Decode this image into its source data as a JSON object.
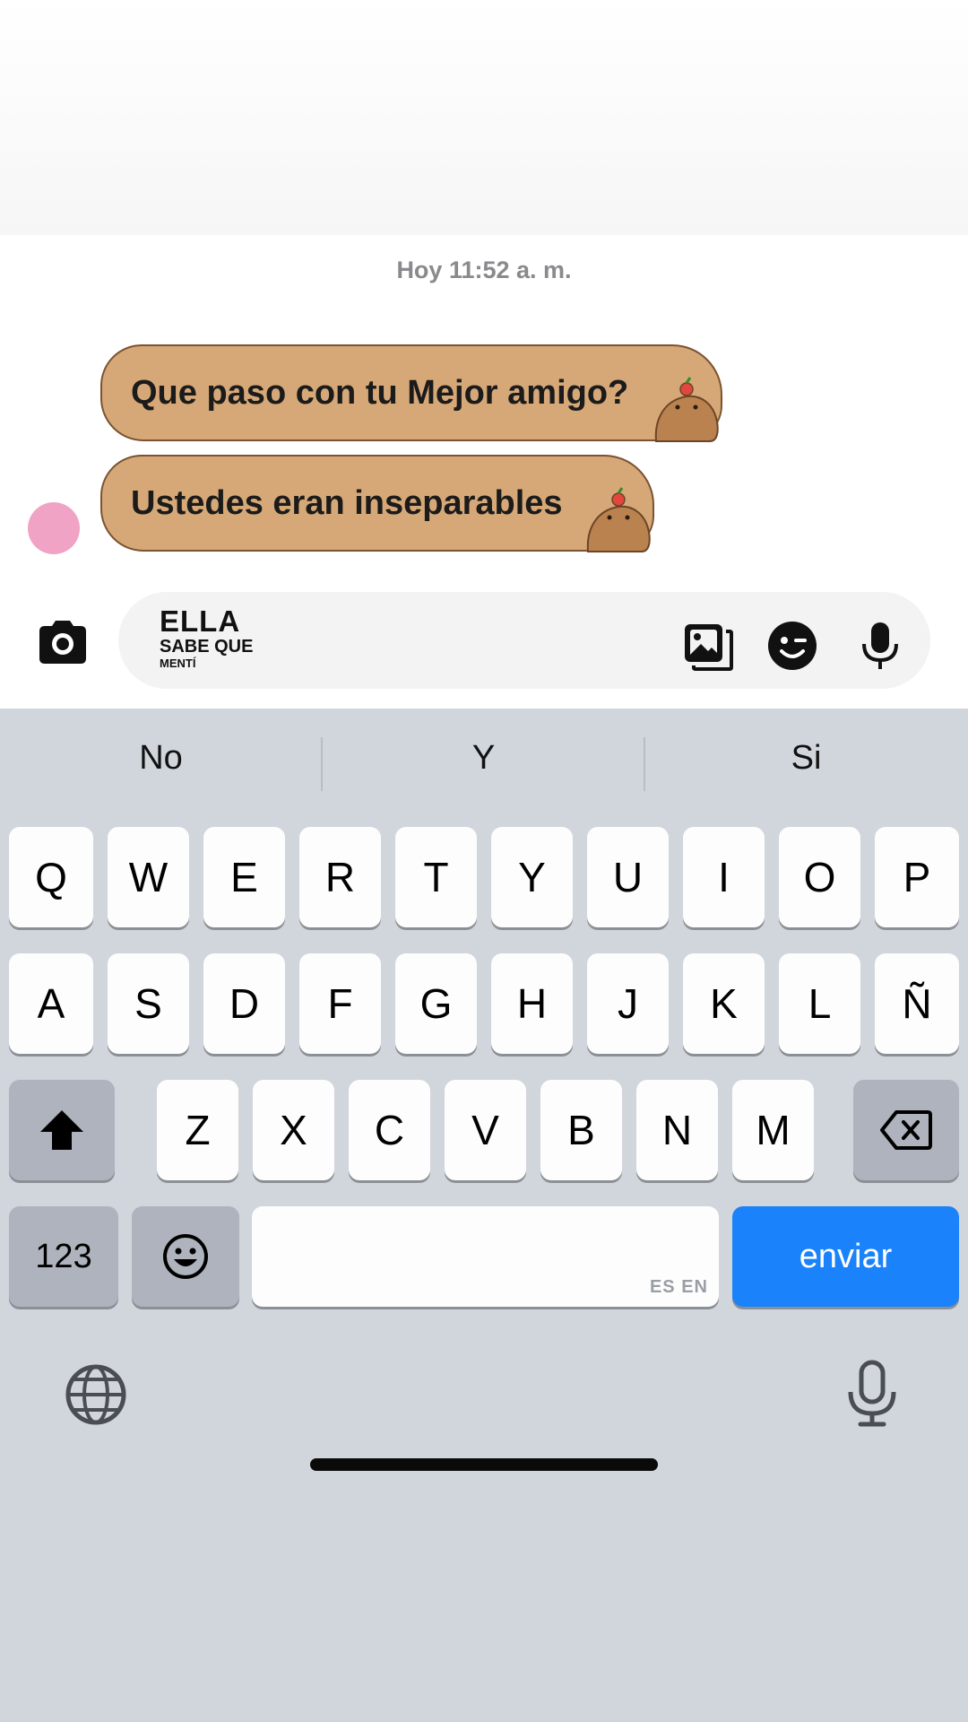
{
  "chat": {
    "timestamp": "Hoy 11:52 a. m.",
    "messages": [
      {
        "text": "Que paso con tu Mejor amigo?"
      },
      {
        "text": "Ustedes eran inseparables"
      }
    ],
    "avatar_color": "#f0a3c4",
    "bubble_color": "#d7a877"
  },
  "composer": {
    "sticker_text": {
      "line1": "ELLA",
      "line2": "SABE QUE",
      "line3": "MENTÍ"
    },
    "icons": [
      "camera-icon",
      "gallery-icon",
      "sticker-icon",
      "microphone-icon"
    ]
  },
  "keyboard": {
    "suggestions": [
      "No",
      "Y",
      "Si"
    ],
    "row1": [
      "Q",
      "W",
      "E",
      "R",
      "T",
      "Y",
      "U",
      "I",
      "O",
      "P"
    ],
    "row2": [
      "A",
      "S",
      "D",
      "F",
      "G",
      "H",
      "J",
      "K",
      "L",
      "Ñ"
    ],
    "row3": [
      "Z",
      "X",
      "C",
      "V",
      "B",
      "N",
      "M"
    ],
    "numbers_key": "123",
    "space_hint": "ES EN",
    "send_key": "enviar",
    "send_color": "#1a82fb"
  }
}
